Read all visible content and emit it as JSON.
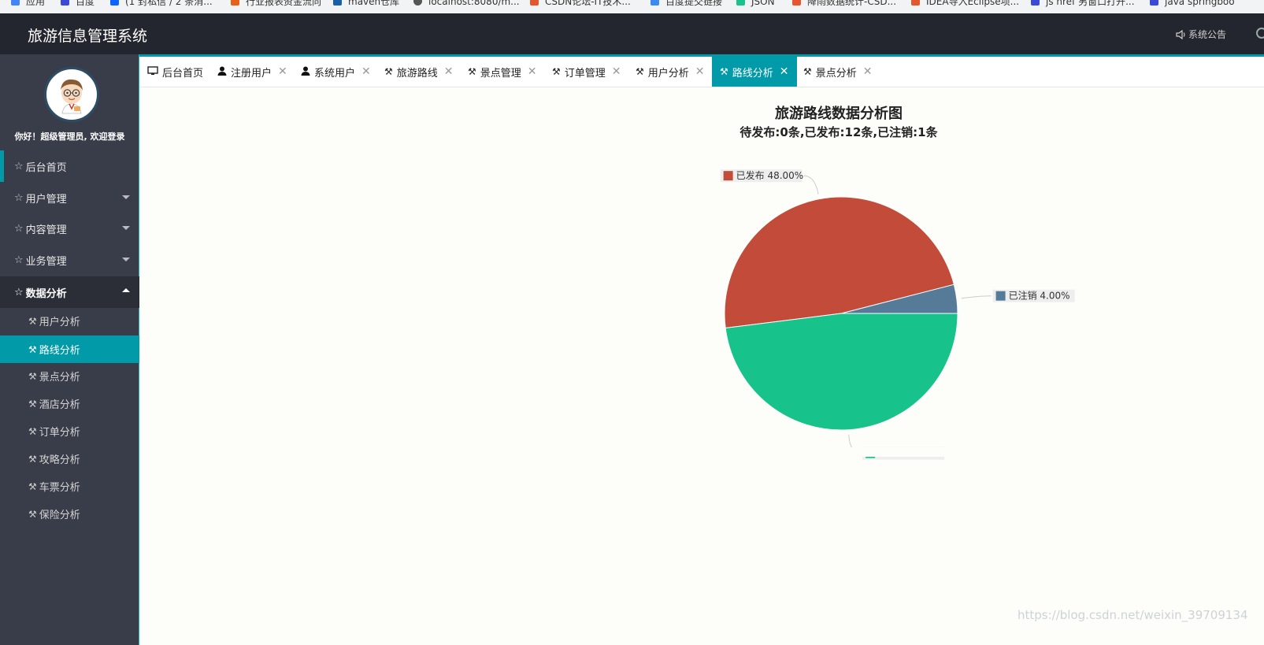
{
  "browser": {
    "bookmarks": [
      {
        "label": "应用",
        "icon": "apps-grid-icon",
        "color": "#4285f4"
      },
      {
        "label": "百度",
        "icon": "baidu-paw-icon",
        "color": "#3a4ad8"
      },
      {
        "label": "(1 封私信 / 2 条消...",
        "icon": "zhihu-icon",
        "color": "#0a66ff"
      },
      {
        "label": "行业报表资金流向",
        "icon": "flame-icon",
        "color": "#e8611a"
      },
      {
        "label": "maven仓库",
        "icon": "maven-icon",
        "color": "#1b5fa8"
      },
      {
        "label": "localhost:8080/m...",
        "icon": "globe-icon",
        "color": "#555555"
      },
      {
        "label": "CSDN论坛-IT技术...",
        "icon": "csdn-icon",
        "color": "#e4572e"
      },
      {
        "label": "百度提交链接",
        "icon": "baidu-paw-icon",
        "color": "#3a8af0"
      },
      {
        "label": "JSON",
        "icon": "json-icon",
        "color": "#19c38a"
      },
      {
        "label": "降雨数据统计-CSD...",
        "icon": "csdn-icon",
        "color": "#e4572e"
      },
      {
        "label": "IDEA导入Eclipse项...",
        "icon": "csdn-icon",
        "color": "#e4572e"
      },
      {
        "label": "js href 另窗口打开...",
        "icon": "baidu-paw-icon",
        "color": "#3a4ad8"
      },
      {
        "label": "java springboo",
        "icon": "baidu-paw-icon",
        "color": "#3a4ad8"
      }
    ]
  },
  "header": {
    "title": "旅游信息管理系统",
    "notice_label": "系统公告"
  },
  "sidebar": {
    "welcome": "你好！超级管理员, 欢迎登录",
    "menu": [
      {
        "label": "后台首页"
      },
      {
        "label": "用户管理"
      },
      {
        "label": "内容管理"
      },
      {
        "label": "业务管理"
      },
      {
        "label": "数据分析"
      }
    ],
    "submenu": [
      {
        "label": "用户分析"
      },
      {
        "label": "路线分析"
      },
      {
        "label": "景点分析"
      },
      {
        "label": "酒店分析"
      },
      {
        "label": "订单分析"
      },
      {
        "label": "攻略分析"
      },
      {
        "label": "车票分析"
      },
      {
        "label": "保险分析"
      }
    ]
  },
  "tabs": [
    {
      "label": "后台首页",
      "icon": "monitor-icon"
    },
    {
      "label": "注册用户",
      "icon": "user-icon"
    },
    {
      "label": "系统用户",
      "icon": "user-icon"
    },
    {
      "label": "旅游路线",
      "icon": "wrench-icon"
    },
    {
      "label": "景点管理",
      "icon": "wrench-icon"
    },
    {
      "label": "订单管理",
      "icon": "wrench-icon"
    },
    {
      "label": "用户分析",
      "icon": "wrench-icon"
    },
    {
      "label": "路线分析",
      "icon": "wrench-icon",
      "active": true
    },
    {
      "label": "景点分析",
      "icon": "wrench-icon"
    }
  ],
  "colors": {
    "accent": "#009aa8",
    "header_bg": "#23262e",
    "sidebar_bg": "#393d49"
  },
  "chart_data": {
    "type": "pie",
    "title": "旅游路线数据分析图",
    "subtitle": "待发布:0条,已发布:12条,已注销:1条",
    "slices": [
      {
        "name": "已发布",
        "percent": 48.0,
        "label": "已发布 48.00%",
        "color": "#c24c39"
      },
      {
        "name": "已注销",
        "percent": 4.0,
        "label": "已注销 4.00%",
        "color": "#557b99"
      },
      {
        "name": "",
        "percent": 48.0,
        "label": "",
        "color": "#17c28b"
      }
    ]
  },
  "watermark": "https://blog.csdn.net/weixin_39709134"
}
